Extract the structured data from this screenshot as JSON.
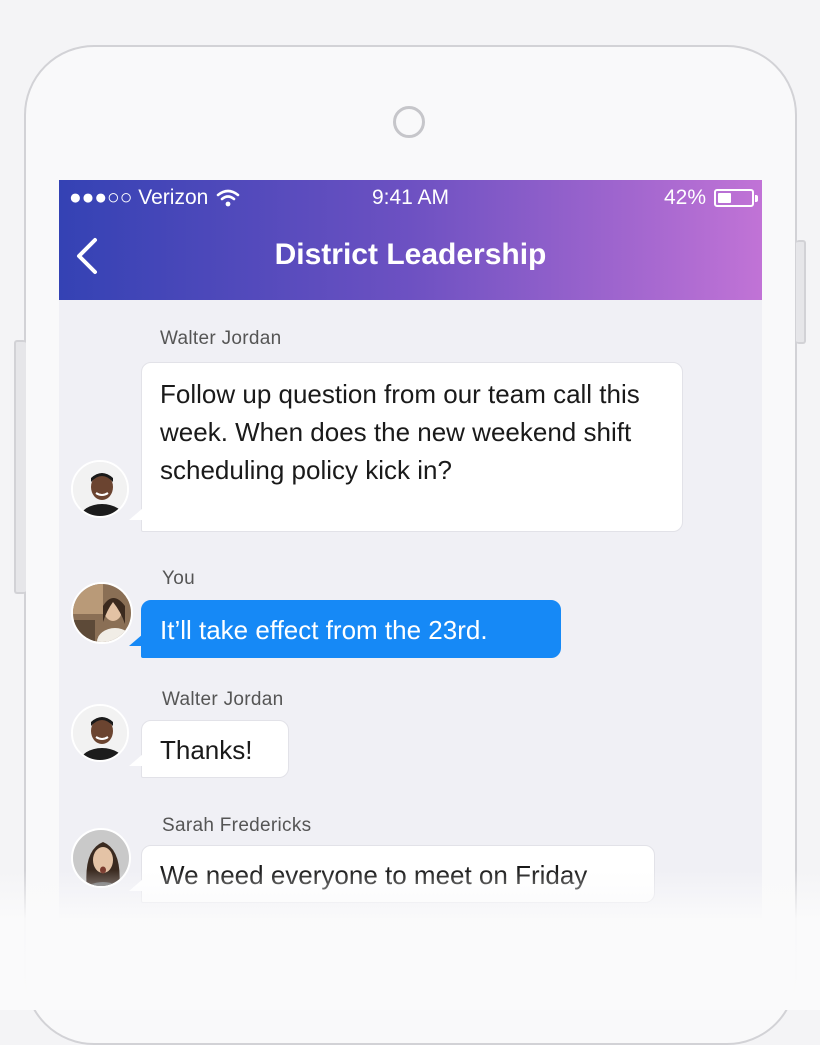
{
  "status_bar": {
    "carrier": "●●●○○ Verizon",
    "time": "9:41 AM",
    "battery": "42%",
    "battery_level": 0.42
  },
  "header": {
    "title": "District Leadership",
    "back_icon": "chevron-left-icon",
    "gradient_start": "#3442b4",
    "gradient_end": "#c173d6"
  },
  "messages": [
    {
      "sender": "Walter Jordan",
      "text": "Follow up question from our team call this week. When does the new weekend shift scheduling policy kick in?",
      "type": "incoming"
    },
    {
      "sender": "You",
      "text": "It’ll take effect from the 23rd.",
      "type": "outgoing"
    },
    {
      "sender": "Walter Jordan",
      "text": "Thanks!",
      "type": "incoming"
    },
    {
      "sender": "Sarah Fredericks",
      "text": "We need everyone to meet on Friday",
      "type": "incoming"
    }
  ],
  "colors": {
    "outgoing_bubble": "#1689f6",
    "incoming_bubble": "#ffffff",
    "chat_background": "#f0f0f5"
  }
}
